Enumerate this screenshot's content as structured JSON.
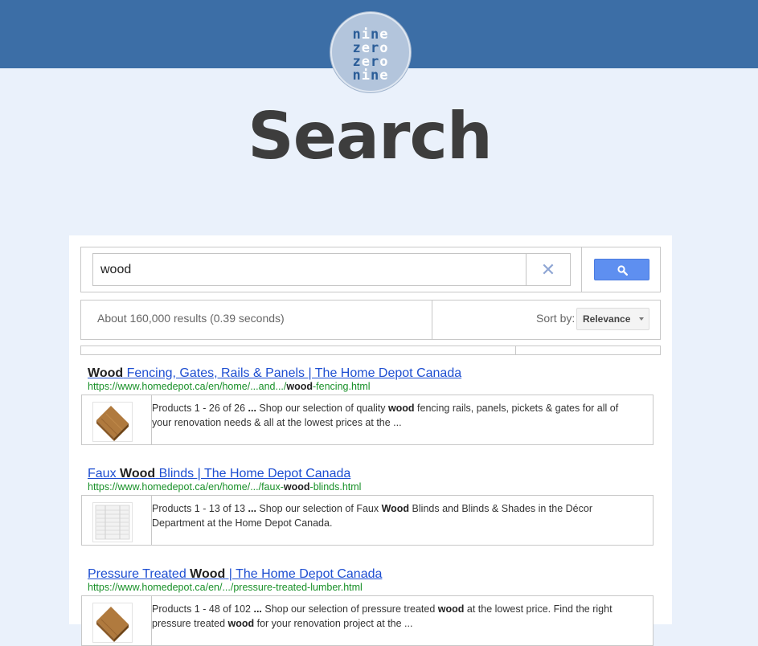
{
  "logo": {
    "lines": [
      [
        "n",
        "i",
        "n",
        "e"
      ],
      [
        "z",
        "e",
        "r",
        "o"
      ],
      [
        "z",
        "e",
        "r",
        "o"
      ],
      [
        "n",
        "i",
        "n",
        "e"
      ]
    ],
    "alt": "nine zero zero nine"
  },
  "page_title": "Search",
  "search": {
    "value": "wood",
    "clear_icon": "close-icon",
    "button_icon": "search-icon"
  },
  "info": {
    "result_count": "About 160,000 results (0.39 seconds)",
    "sort_label": "Sort by:",
    "sort_value": "Relevance"
  },
  "results": [
    {
      "title_parts": [
        {
          "t": "Wood",
          "b": true
        },
        {
          "t": " Fencing, Gates, Rails & Panels | The Home Depot Canada",
          "b": false
        }
      ],
      "url_parts": [
        {
          "t": "https://www.homedepot.ca/en/home/...and.../",
          "b": false
        },
        {
          "t": "wood",
          "b": true
        },
        {
          "t": "-fencing.html",
          "b": false
        }
      ],
      "snippet_line1": [
        {
          "t": "Products 1 - 26 of 26 ",
          "b": false
        },
        {
          "t": "...",
          "b": true
        },
        {
          "t": " Shop our selection of quality ",
          "b": false
        },
        {
          "t": "wood",
          "b": true
        },
        {
          "t": " fencing rails, panels, pickets & gates for all of",
          "b": false
        }
      ],
      "snippet_line2": [
        {
          "t": "your renovation needs & all at the lowest prices at the ...",
          "b": false
        }
      ],
      "thumb": "wood-plank"
    },
    {
      "title_parts": [
        {
          "t": "Faux ",
          "b": false
        },
        {
          "t": "Wood",
          "b": true
        },
        {
          "t": " Blinds | The Home Depot Canada",
          "b": false
        }
      ],
      "url_parts": [
        {
          "t": "https://www.homedepot.ca/en/home/.../faux-",
          "b": false
        },
        {
          "t": "wood",
          "b": true
        },
        {
          "t": "-blinds.html",
          "b": false
        }
      ],
      "snippet_line1": [
        {
          "t": "Products 1 - 13 of 13 ",
          "b": false
        },
        {
          "t": "...",
          "b": true
        },
        {
          "t": " Shop our selection of Faux ",
          "b": false
        },
        {
          "t": "Wood",
          "b": true
        },
        {
          "t": " Blinds and Blinds & Shades in the Décor",
          "b": false
        }
      ],
      "snippet_line2": [
        {
          "t": "Department at the Home Depot Canada.",
          "b": false
        }
      ],
      "thumb": "white-blinds"
    },
    {
      "title_parts": [
        {
          "t": "Pressure Treated ",
          "b": false
        },
        {
          "t": "Wood",
          "b": true
        },
        {
          "t": " | The Home Depot Canada",
          "b": false
        }
      ],
      "url_parts": [
        {
          "t": "https://www.homedepot.ca/en/.../pressure-treated-lumber.html",
          "b": false
        }
      ],
      "snippet_line1": [
        {
          "t": "Products 1 - 48 of 102 ",
          "b": false
        },
        {
          "t": "...",
          "b": true
        },
        {
          "t": " Shop our selection of pressure treated ",
          "b": false
        },
        {
          "t": "wood",
          "b": true
        },
        {
          "t": " at the lowest price. Find the right",
          "b": false
        }
      ],
      "snippet_line2": [
        {
          "t": "pressure treated ",
          "b": false
        },
        {
          "t": "wood",
          "b": true
        },
        {
          "t": " for your renovation project at the ...",
          "b": false
        }
      ],
      "thumb": "wood-plank"
    }
  ],
  "colors": {
    "topbar": "#3c6ea6",
    "background": "#eaf1fb",
    "link": "#1d4ed1",
    "url": "#189028",
    "search_button": "#5e8ff0"
  }
}
